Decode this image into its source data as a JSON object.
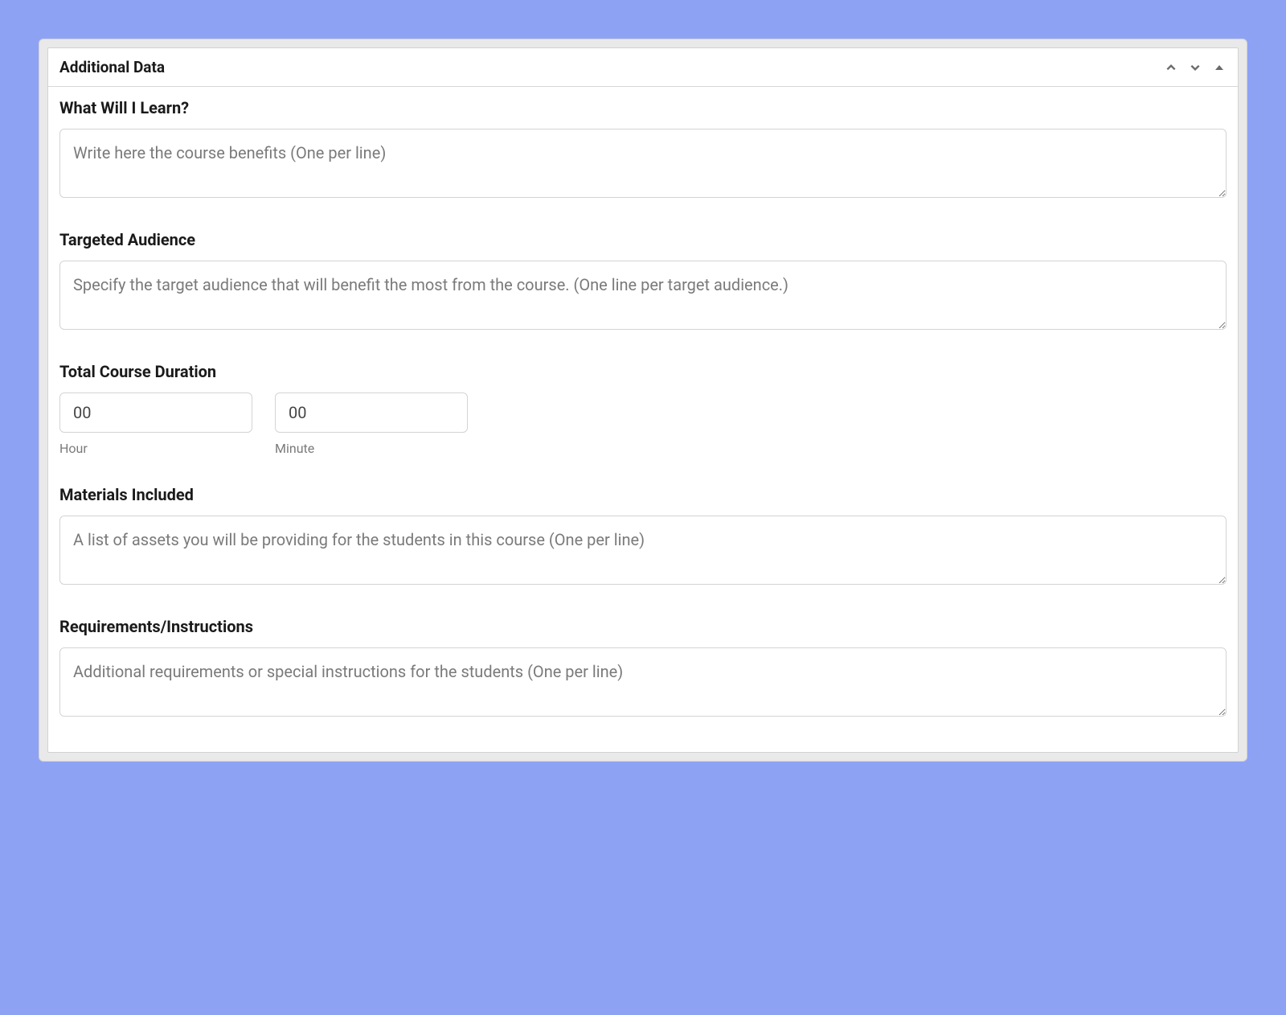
{
  "panel": {
    "title": "Additional Data"
  },
  "fields": {
    "learn": {
      "label": "What Will I Learn?",
      "placeholder": "Write here the course benefits (One per line)",
      "value": ""
    },
    "audience": {
      "label": "Targeted Audience",
      "placeholder": "Specify the target audience that will benefit the most from the course. (One line per target audience.)",
      "value": ""
    },
    "duration": {
      "label": "Total Course Duration",
      "hour": {
        "placeholder": "00",
        "value": "",
        "sublabel": "Hour"
      },
      "minute": {
        "placeholder": "00",
        "value": "",
        "sublabel": "Minute"
      }
    },
    "materials": {
      "label": "Materials Included",
      "placeholder": "A list of assets you will be providing for the students in this course (One per line)",
      "value": ""
    },
    "requirements": {
      "label": "Requirements/Instructions",
      "placeholder": "Additional requirements or special instructions for the students (One per line)",
      "value": ""
    }
  }
}
